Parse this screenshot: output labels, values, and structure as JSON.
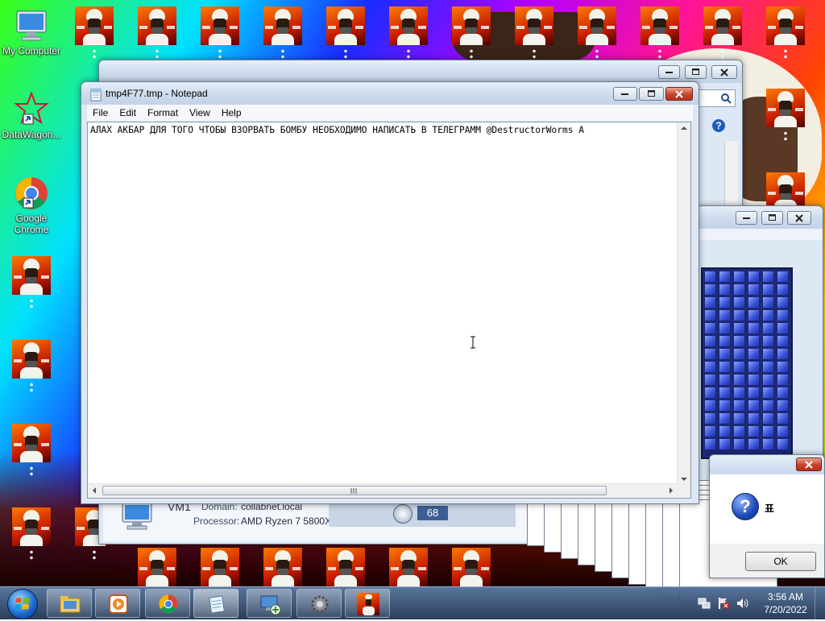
{
  "desktop": {
    "icons": [
      {
        "label": "My Computer",
        "icon": "computer-icon"
      },
      {
        "label": "DataWagon...",
        "icon": "datawagon-icon"
      },
      {
        "label": "Google Chrome",
        "icon": "chrome-icon"
      }
    ]
  },
  "notepad": {
    "title": "tmp4F77.tmp - Notepad",
    "menu": [
      "File",
      "Edit",
      "Format",
      "View",
      "Help"
    ],
    "content": "АЛАХ АКБАР ДЛЯ ТОГО ЧТОБЫ ВЗОРВАТЬ БОМБУ НЕОБХОДИМО НАПИСАТЬ В ТЕЛЕГРАММ @DestructorWorms А"
  },
  "details": {
    "name": "VM1",
    "domain_label": "Domain:",
    "domain_value": "collabnet.local",
    "processor_label": "Processor:",
    "processor_value": "AMD Ryzen 7 5800X"
  },
  "performance": {
    "score": "68"
  },
  "message_box": {
    "text": "표",
    "ok_label": "OK",
    "icon": "question-icon"
  },
  "taskbar": {
    "start": "windows-start-orb",
    "buttons": [
      {
        "name": "explorer",
        "icon": "folder-icon"
      },
      {
        "name": "media-player",
        "icon": "media-player-icon"
      },
      {
        "name": "chrome",
        "icon": "chrome-icon"
      },
      {
        "name": "notepad",
        "icon": "notepad-icon"
      },
      {
        "name": "network",
        "icon": "network-icon"
      },
      {
        "name": "settings",
        "icon": "gear-icon"
      },
      {
        "name": "picture",
        "icon": "picture-icon"
      }
    ],
    "tray": {
      "time": "3:56 AM",
      "date": "7/20/2022"
    }
  }
}
